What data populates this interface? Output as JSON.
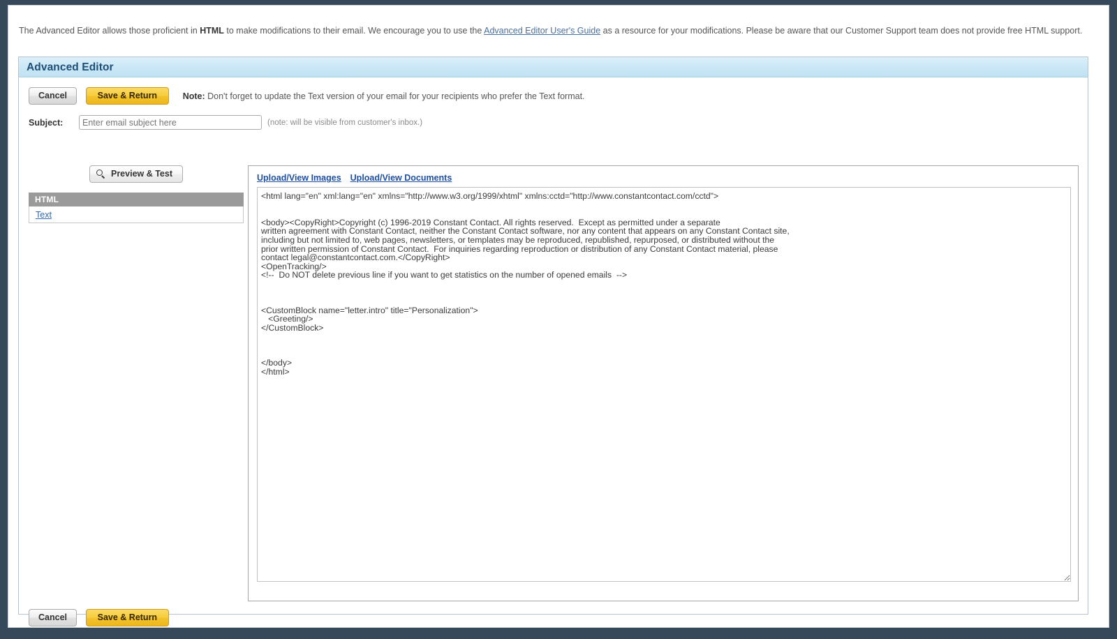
{
  "intro": {
    "part1": "The Advanced Editor allows those proficient in ",
    "bold1": "HTML",
    "part2": " to make modifications to their email. We encourage you to use the ",
    "link": "Advanced Editor User's Guide",
    "part3": " as a resource for your modifications. Please be aware that our Customer Support team does not provide free HTML support."
  },
  "panel": {
    "title": "Advanced Editor"
  },
  "toolbar": {
    "cancel_label": "Cancel",
    "save_label": "Save & Return",
    "note_label": "Note:",
    "note_text": " Don't forget to update the Text version of your email for your recipients who prefer the Text format."
  },
  "subject": {
    "label": "Subject:",
    "value": "",
    "placeholder": "Enter email subject here",
    "hint": "(note: will be visible from customer's inbox.)"
  },
  "left_column": {
    "preview_label": "Preview & Test",
    "tab_html": "HTML",
    "tab_text": "Text"
  },
  "editor": {
    "upload_images_label": "Upload/View Images",
    "upload_documents_label": "Upload/View Documents",
    "html_source": "<html lang=\"en\" xml:lang=\"en\" xmlns=\"http://www.w3.org/1999/xhtml\" xmlns:cctd=\"http://www.constantcontact.com/cctd\">\n\n\n<body><CopyRight>Copyright (c) 1996-2019 Constant Contact. All rights reserved.  Except as permitted under a separate\nwritten agreement with Constant Contact, neither the Constant Contact software, nor any content that appears on any Constant Contact site,\nincluding but not limited to, web pages, newsletters, or templates may be reproduced, republished, repurposed, or distributed without the\nprior written permission of Constant Contact.  For inquiries regarding reproduction or distribution of any Constant Contact material, please\ncontact legal@constantcontact.com.</CopyRight>\n<OpenTracking/>\n<!--  Do NOT delete previous line if you want to get statistics on the number of opened emails  -->\n\n\n\n<CustomBlock name=\"letter.intro\" title=\"Personalization\">\n   <Greeting/>\n</CustomBlock>\n\n\n\n</body>\n</html>"
  },
  "bottom_toolbar": {
    "cancel_label": "Cancel",
    "save_label": "Save & Return"
  },
  "colors": {
    "page_background": "#36495a",
    "panel_header": "#cbe8f6",
    "panel_title": "#1f4e79",
    "gold_button": "#f2c22c",
    "link_blue": "#1f4fa0",
    "tab_active": "#9a9a9a"
  },
  "icons": {
    "magnifier": "search-icon",
    "resize_handle": "resize-grip-icon"
  }
}
